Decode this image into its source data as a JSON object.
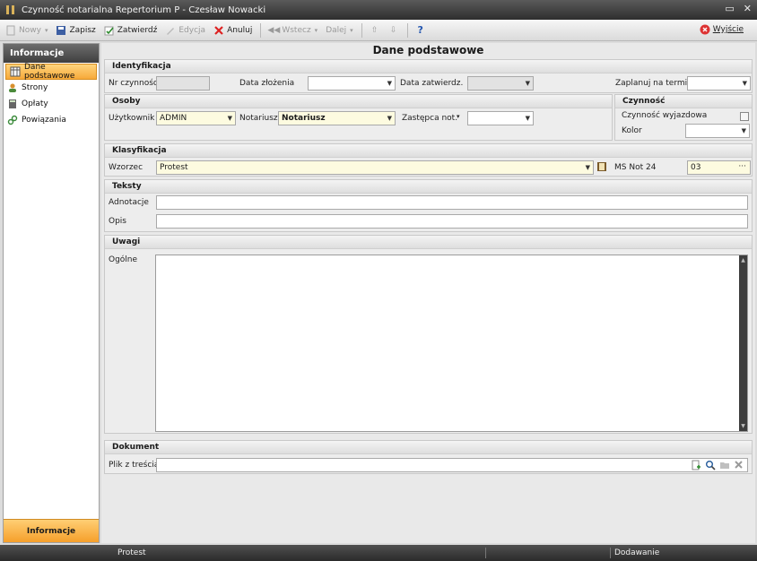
{
  "window": {
    "title": "Czynność notarialna Repertorium P - Czesław Nowacki",
    "min_glyph": "▭",
    "close_glyph": "✕"
  },
  "toolbar": {
    "new_label": "Nowy",
    "save_label": "Zapisz",
    "approve_label": "Zatwierdź",
    "edit_label": "Edycja",
    "cancel_label": "Anuluj",
    "back_label": "Wstecz",
    "next_label": "Dalej",
    "help_glyph": "?",
    "exit_label": "Wyjście"
  },
  "sidebar": {
    "header": "Informacje",
    "items": [
      {
        "label": "Dane podstawowe",
        "icon": "grid-icon"
      },
      {
        "label": "Strony",
        "icon": "person-icon"
      },
      {
        "label": "Opłaty",
        "icon": "calculator-icon"
      },
      {
        "label": "Powiązania",
        "icon": "link-icon"
      }
    ],
    "footer": "Informacje"
  },
  "main": {
    "title": "Dane podstawowe",
    "identyfikacja": {
      "header": "Identyfikacja",
      "nr_label": "Nr czynności",
      "nr_value": "",
      "data_zlozenia_label": "Data złożenia",
      "data_zatwierdz_label": "Data zatwierdz.",
      "zaplanuj_label": "Zaplanuj na termin"
    },
    "osoby": {
      "header": "Osoby",
      "uzytkownik_label": "Użytkownik",
      "uzytkownik_value": "ADMIN",
      "notariusz_label": "Notariusz",
      "notariusz_value": "Notariusz",
      "zastepca_label": "Zastępca not.",
      "zastepca_value": ""
    },
    "czynnosc": {
      "header": "Czynność",
      "wyjazdowa_label": "Czynność wyjazdowa",
      "kolor_label": "Kolor"
    },
    "klasyfikacja": {
      "header": "Klasyfikacja",
      "wzorzec_label": "Wzorzec",
      "wzorzec_value": "Protest",
      "ms_label": "MS Not 24",
      "ms_value": "03"
    },
    "teksty": {
      "header": "Teksty",
      "adnotacje_label": "Adnotacje",
      "opis_label": "Opis"
    },
    "uwagi": {
      "header": "Uwagi",
      "ogolne_label": "Ogólne"
    },
    "dokument": {
      "header": "Dokument",
      "plik_label": "Plik z treścią"
    }
  },
  "status": {
    "left": "Protest",
    "right": "Dodawanie"
  },
  "colors": {
    "accent": "#f7a93a",
    "titlebar": "#3a3a3a",
    "field_highlight": "#fdfbe0"
  }
}
